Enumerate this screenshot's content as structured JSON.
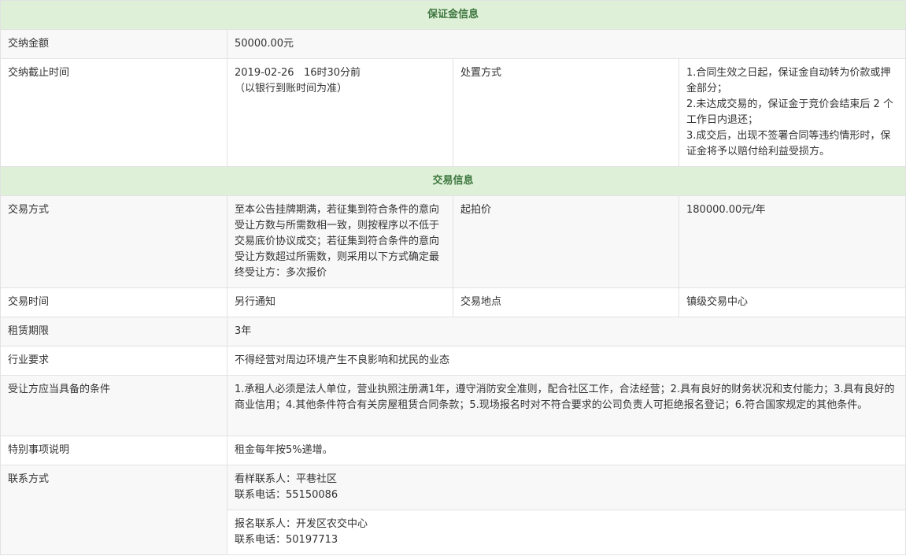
{
  "deposit": {
    "section_title": "保证金信息",
    "amount_label": "交纳金额",
    "amount_value": "50000.00元",
    "deadline_label": "交纳截止时间",
    "deadline_line1": "2019-02-26   16时30分前",
    "deadline_line2": "（以银行到账时间为准）",
    "disposal_label": "处置方式",
    "disposal_lines": [
      "1.合同生效之日起，保证金自动转为价款或押金部分；",
      "2.未达成交易的，保证金于竞价会结束后 2 个工作日内退还；",
      "3.成交后，出现不签署合同等违约情形时，保证金将予以赔付给利益受损方。"
    ]
  },
  "trade": {
    "section_title": "交易信息",
    "method_label": "交易方式",
    "method_value": "至本公告挂牌期满，若征集到符合条件的意向受让方数与所需数相一致，则按程序以不低于交易底价协议成交；若征集到符合条件的意向受让方数超过所需数，则采用以下方式确定最终受让方：多次报价",
    "start_price_label": "起拍价",
    "start_price_value": "180000.00元/年",
    "time_label": "交易时间",
    "time_value": "另行通知",
    "place_label": "交易地点",
    "place_value": "镇级交易中心",
    "lease_label": "租赁期限",
    "lease_value": "3年",
    "industry_label": "行业要求",
    "industry_value": "不得经营对周边环境产生不良影响和扰民的业态",
    "conditions_label": "受让方应当具备的条件",
    "conditions_value": "1.承租人必须是法人单位，营业执照注册满1年，遵守消防安全准则，配合社区工作，合法经营；2.具有良好的财务状况和支付能力；3.具有良好的商业信用；4.其他条件符合有关房屋租赁合同条款；5.现场报名时对不符合要求的公司负责人可拒绝报名登记；6.符合国家规定的其他条件。",
    "special_label": "特别事项说明",
    "special_value": "租金每年按5%递增。",
    "contact_label": "联系方式",
    "contact1_line1": "看样联系人：平巷社区",
    "contact1_line2": "联系电话：55150086",
    "contact2_line1": "报名联系人：开发区农交中心",
    "contact2_line2": "联系电话：50197713"
  }
}
